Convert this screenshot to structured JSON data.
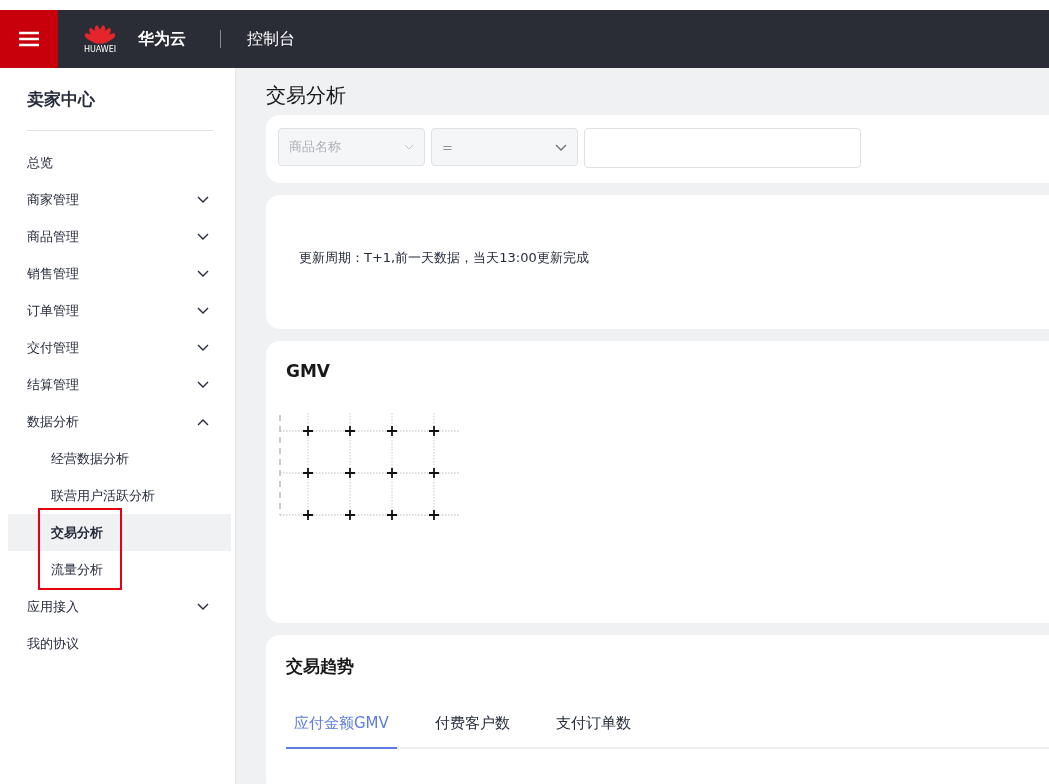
{
  "header": {
    "brand_logo_text": "HUAWEI",
    "brand": "华为云",
    "console": "控制台"
  },
  "sidebar": {
    "title": "卖家中心",
    "items": [
      {
        "label": "总览",
        "expandable": false,
        "selected": false
      },
      {
        "label": "商家管理",
        "expandable": true,
        "expanded": false,
        "selected": false
      },
      {
        "label": "商品管理",
        "expandable": true,
        "expanded": false,
        "selected": false
      },
      {
        "label": "销售管理",
        "expandable": true,
        "expanded": false,
        "selected": false
      },
      {
        "label": "订单管理",
        "expandable": true,
        "expanded": false,
        "selected": false
      },
      {
        "label": "交付管理",
        "expandable": true,
        "expanded": false,
        "selected": false
      },
      {
        "label": "结算管理",
        "expandable": true,
        "expanded": false,
        "selected": false
      },
      {
        "label": "数据分析",
        "expandable": true,
        "expanded": true,
        "selected": false,
        "children": [
          {
            "label": "经营数据分析",
            "selected": false
          },
          {
            "label": "联营用户活跃分析",
            "selected": false
          },
          {
            "label": "交易分析",
            "selected": true
          },
          {
            "label": "流量分析",
            "selected": false
          }
        ]
      },
      {
        "label": "应用接入",
        "expandable": true,
        "expanded": false,
        "selected": false
      },
      {
        "label": "我的协议",
        "expandable": false,
        "selected": false
      }
    ]
  },
  "page_title": "交易分析",
  "filter": {
    "field_select": {
      "value": "商品名称",
      "disabled": true
    },
    "operator_select": {
      "value": "=",
      "disabled": false
    }
  },
  "update_note": "更新周期：T+1,前一天数据，当天13:00更新完成",
  "gmv_card": {
    "title": "GMV"
  },
  "trend_card": {
    "title": "交易趋势",
    "tabs": [
      {
        "label": "应付金额GMV",
        "selected": true
      },
      {
        "label": "付费客户数",
        "selected": false
      },
      {
        "label": "支付订单数",
        "selected": false
      }
    ]
  }
}
